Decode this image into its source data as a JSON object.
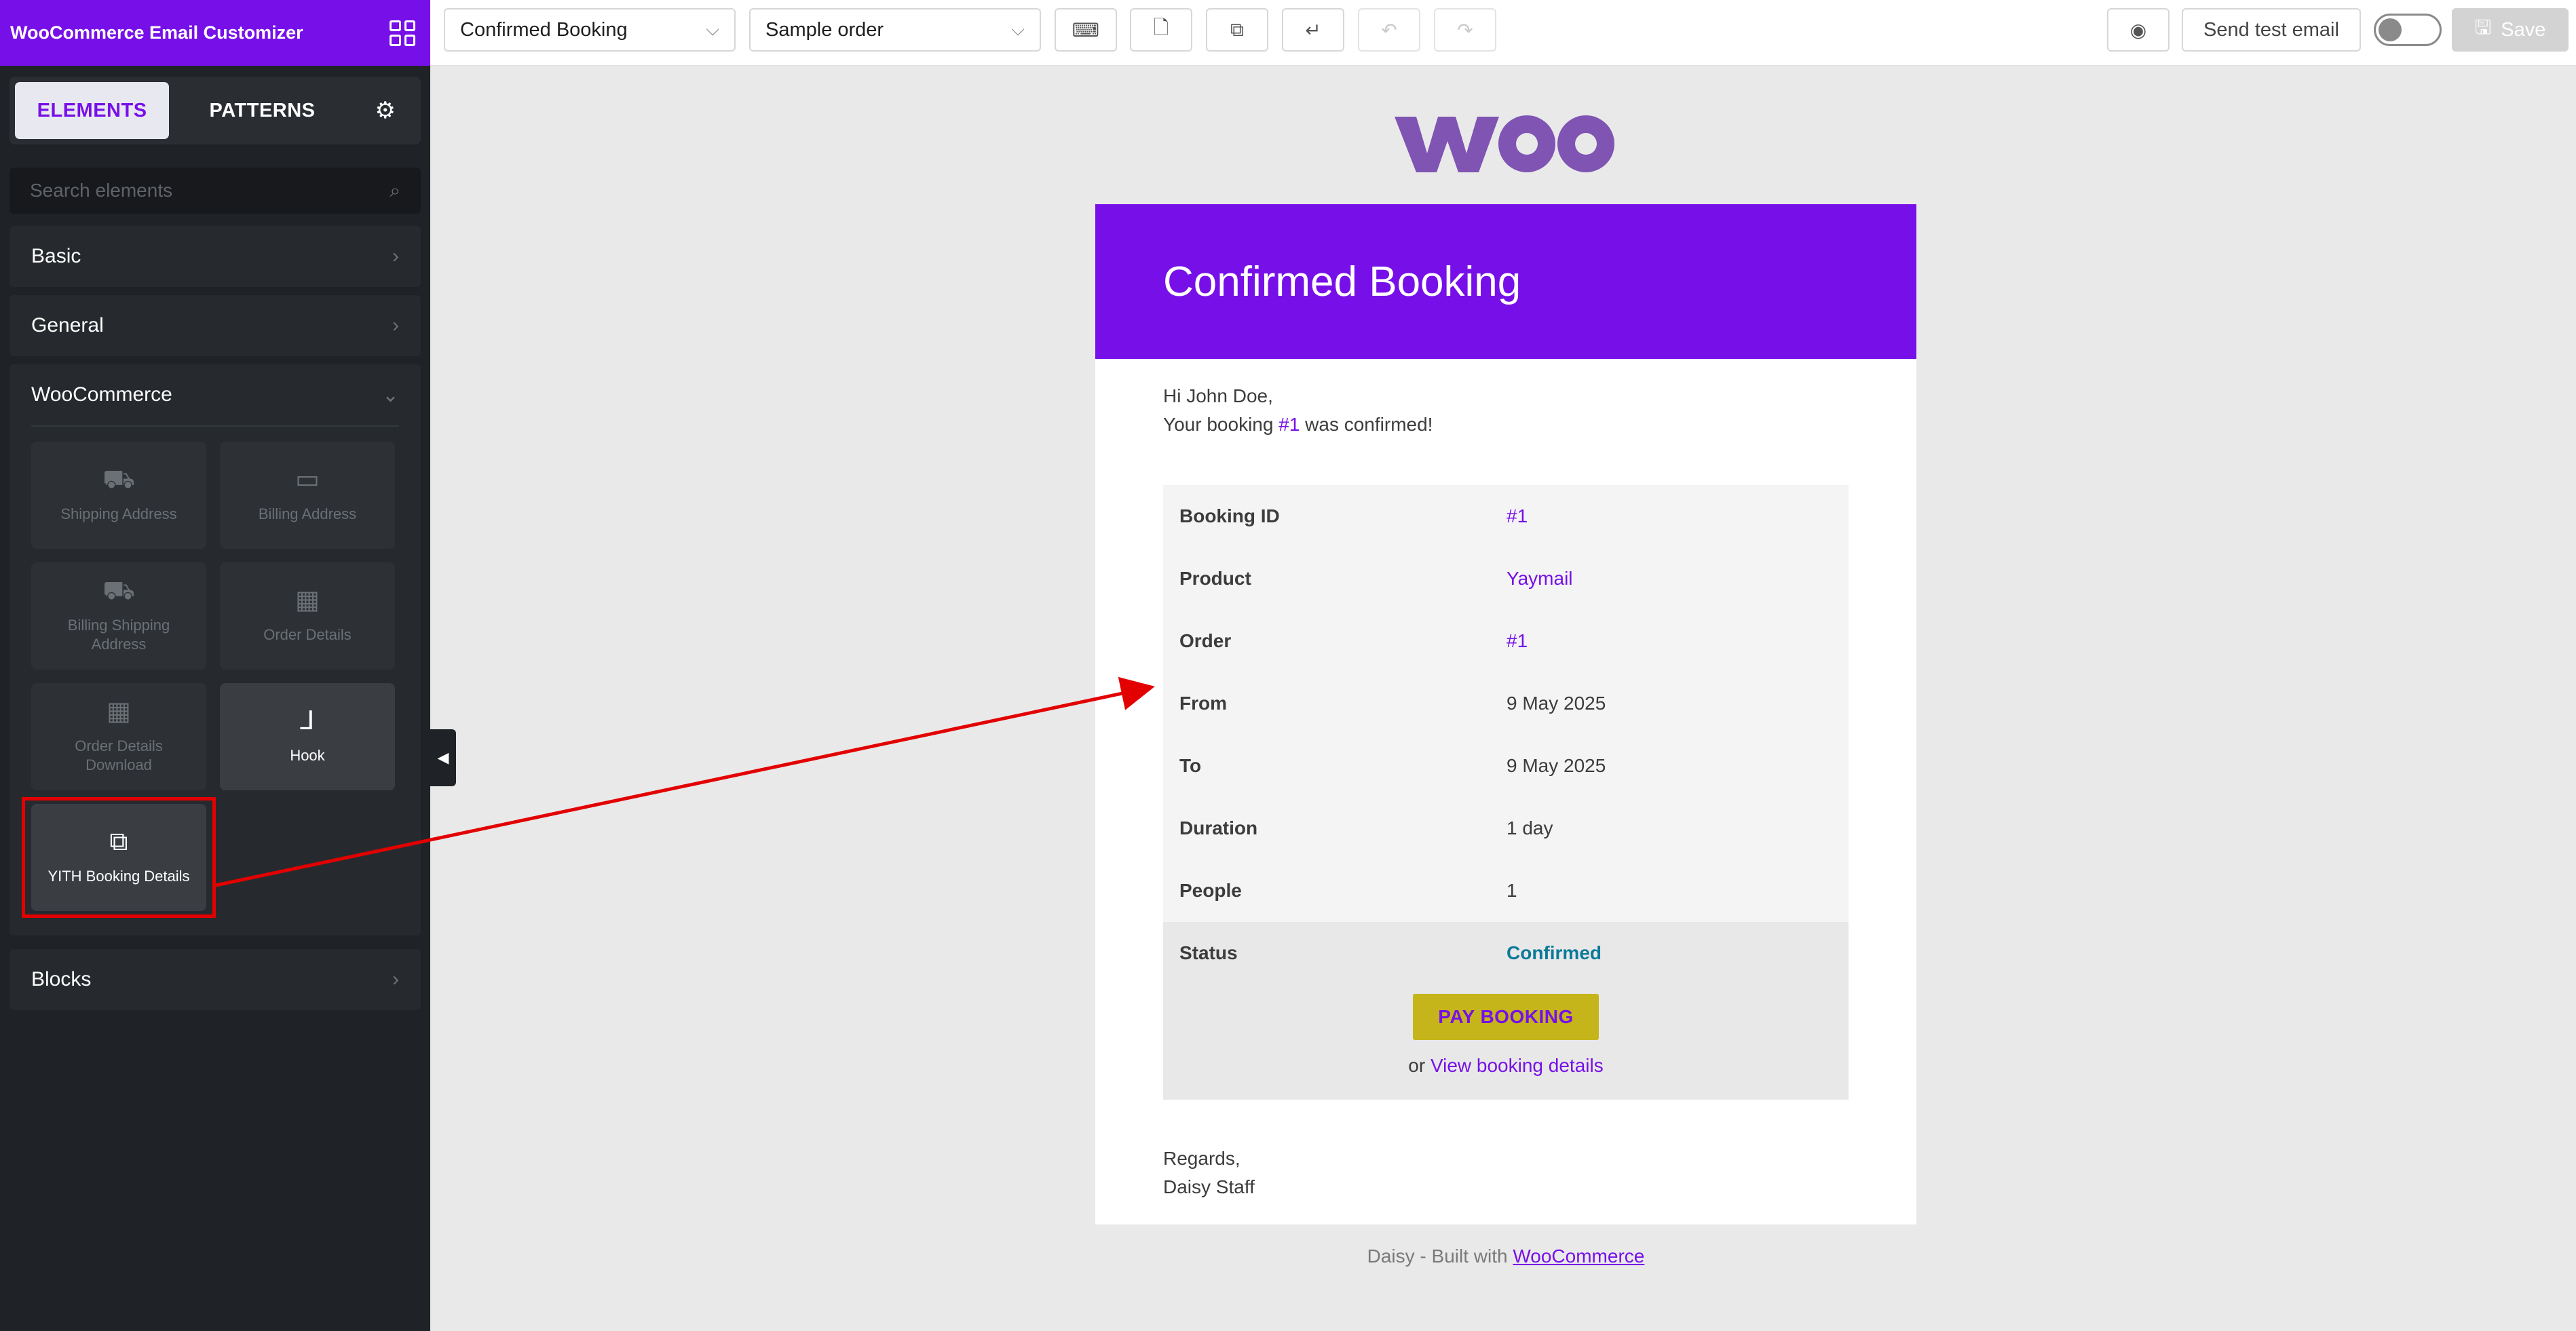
{
  "sidebar": {
    "title": "WooCommerce Email Customizer",
    "tabs": {
      "elements": "ELEMENTS",
      "patterns": "PATTERNS"
    },
    "search_placeholder": "Search elements",
    "sections": {
      "basic": "Basic",
      "general": "General",
      "woocommerce": "WooCommerce",
      "blocks": "Blocks"
    },
    "cards": [
      {
        "label": "Shipping Address",
        "icon": "truck-icon"
      },
      {
        "label": "Billing Address",
        "icon": "id-card-icon"
      },
      {
        "label": "Billing Shipping Address",
        "icon": "truck-card-icon"
      },
      {
        "label": "Order Details",
        "icon": "table-icon"
      },
      {
        "label": "Order Details Download",
        "icon": "table-icon"
      },
      {
        "label": "Hook",
        "icon": "hook-icon"
      },
      {
        "label": "YITH Booking Details",
        "icon": "booking-icon"
      }
    ]
  },
  "toolbar": {
    "email_type": "Confirmed Booking",
    "order_select": "Sample order",
    "send_test": "Send test email",
    "save": "Save"
  },
  "email": {
    "heading": "Confirmed Booking",
    "greeting": "Hi John Doe,",
    "line_prefix": "Your booking ",
    "line_link": "#1",
    "line_suffix": " was confirmed!",
    "rows": [
      {
        "key": "Booking ID",
        "value": "#1",
        "link": true
      },
      {
        "key": "Product",
        "value": "Yaymail",
        "link": true
      },
      {
        "key": "Order",
        "value": "#1",
        "link": true
      },
      {
        "key": "From",
        "value": "9 May 2025",
        "link": false
      },
      {
        "key": "To",
        "value": "9 May 2025",
        "link": false
      },
      {
        "key": "Duration",
        "value": "1 day",
        "link": false
      },
      {
        "key": "People",
        "value": "1",
        "link": false
      }
    ],
    "status_label": "Status",
    "status_value": "Confirmed",
    "pay_button": "PAY BOOKING",
    "or_text": "or ",
    "view_link": "View booking details",
    "regards": "Regards,",
    "signature": "Daisy Staff"
  },
  "footer": {
    "prefix": "Daisy - Built with ",
    "link": "WooCommerce"
  },
  "colors": {
    "brand_purple": "#7710e8",
    "pay_button_bg": "#c5b51a",
    "status_color": "#0c7a9a",
    "annotation_red": "#e30000"
  }
}
